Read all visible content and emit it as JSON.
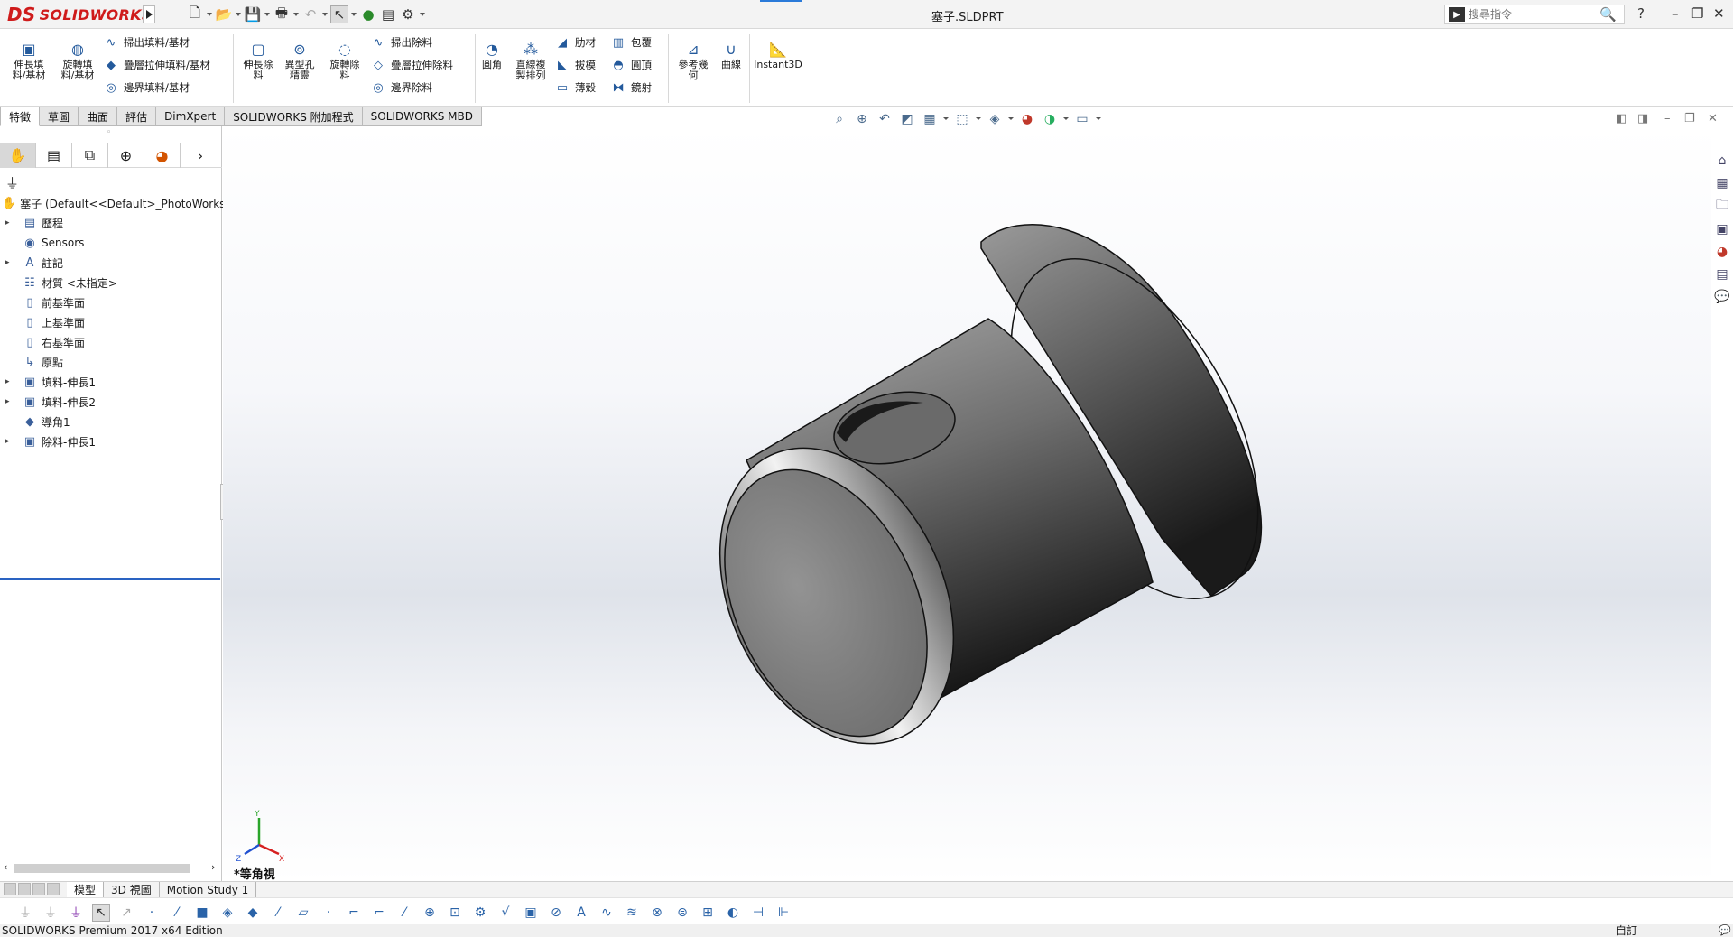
{
  "app": {
    "brand_ds": "DS",
    "brand_name": "SOLIDWORKS",
    "document_title": "塞子.SLDPRT"
  },
  "search": {
    "placeholder": "搜尋指令"
  },
  "ribbon": {
    "extrude_boss": "伸長填\n料/基材",
    "revolve_boss": "旋轉填\n料/基材",
    "swept_boss": "掃出填料/基材",
    "lofted_boss": "疊層拉伸填料/基材",
    "boundary_boss": "邊界填料/基材",
    "extrude_cut": "伸長除\n料",
    "hole_wizard": "異型孔\n精靈",
    "revolve_cut": "旋轉除\n料",
    "swept_cut": "掃出除料",
    "lofted_cut": "疊層拉伸除料",
    "boundary_cut": "邊界除料",
    "fillet": "圓角",
    "linear_pattern": "直線複\n製排列",
    "rib": "肋材",
    "draft": "拔模",
    "shell": "薄殼",
    "wrap": "包覆",
    "dome": "圓頂",
    "mirror": "鏡射",
    "ref_geometry": "參考幾\n何",
    "curves": "曲線",
    "instant3d": "Instant3D"
  },
  "tabs": [
    "特徵",
    "草圖",
    "曲面",
    "評估",
    "DimXpert",
    "SOLIDWORKS 附加程式",
    "SOLIDWORKS MBD"
  ],
  "tree": {
    "root": "塞子  (Default<<Default>_PhotoWorks",
    "items": [
      {
        "label": "歷程",
        "expand": true
      },
      {
        "label": "Sensors",
        "expand": false
      },
      {
        "label": "註記",
        "expand": true
      },
      {
        "label": "材質 <未指定>",
        "expand": false
      },
      {
        "label": "前基準面",
        "expand": false
      },
      {
        "label": "上基準面",
        "expand": false
      },
      {
        "label": "右基準面",
        "expand": false
      },
      {
        "label": "原點",
        "expand": false
      },
      {
        "label": "填料-伸長1",
        "expand": true
      },
      {
        "label": "填料-伸長2",
        "expand": true
      },
      {
        "label": "導角1",
        "expand": false
      },
      {
        "label": "除料-伸長1",
        "expand": true
      }
    ]
  },
  "viewport": {
    "view_name": "*等角視",
    "triad_x": "X",
    "triad_y": "Y",
    "triad_z": "Z"
  },
  "bottom_tabs": [
    "模型",
    "3D 視圖",
    "Motion Study 1"
  ],
  "status": {
    "left": "SOLIDWORKS Premium 2017 x64 Edition",
    "right": "自訂"
  }
}
